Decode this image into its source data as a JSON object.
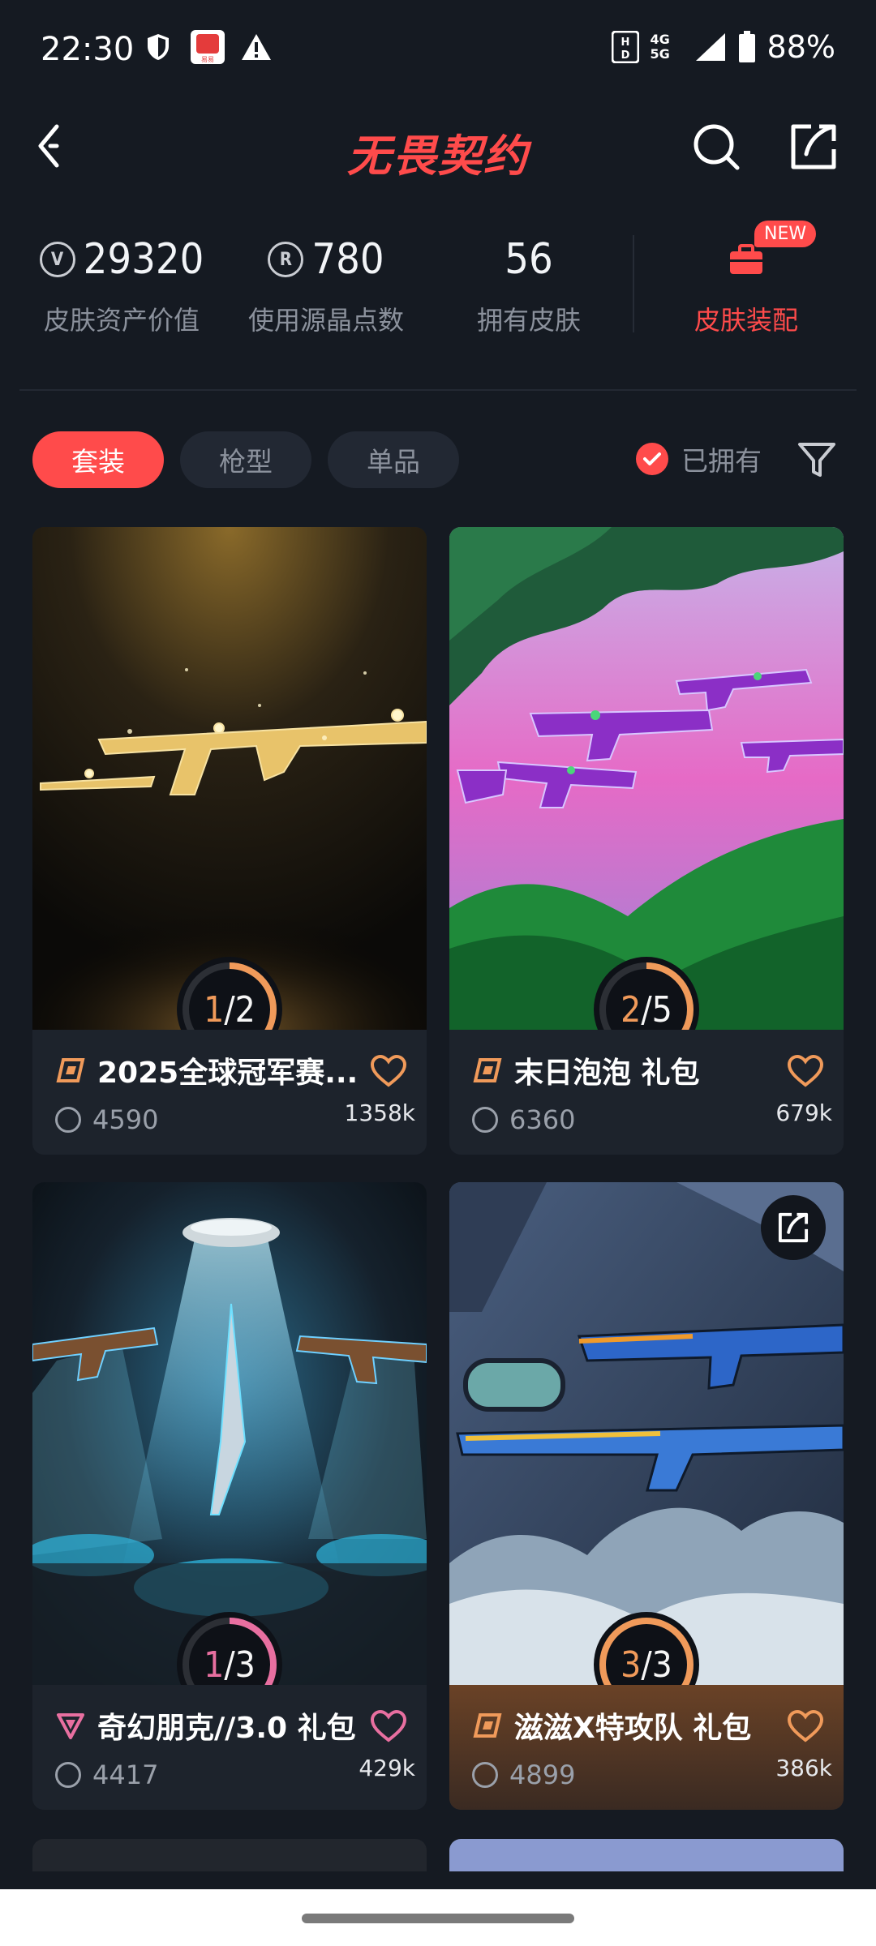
{
  "status_bar": {
    "time": "22:30",
    "network": "4G 5G",
    "battery": "88%",
    "icons": [
      "shield-icon",
      "app-notification-icon",
      "warning-icon",
      "hd-icon",
      "signal-icon",
      "battery-icon"
    ]
  },
  "header": {
    "title": "无畏契约",
    "back_icon": "back-arrow-icon",
    "search_icon": "search-icon",
    "share_icon": "share-icon"
  },
  "stats": [
    {
      "value": "29320",
      "label": "皮肤资产价值",
      "icon": "vp-coin-icon"
    },
    {
      "value": "780",
      "label": "使用源晶点数",
      "icon": "radianite-icon"
    },
    {
      "value": "56",
      "label": "拥有皮肤"
    }
  ],
  "equip": {
    "label": "皮肤装配",
    "badge": "NEW",
    "icon": "briefcase-icon"
  },
  "filters": {
    "tabs": [
      "套装",
      "枪型",
      "单品"
    ],
    "active_tab": "套装",
    "owned_label": "已拥有",
    "owned_checked": true
  },
  "cards": [
    {
      "title": "2025全球冠军赛...",
      "price": "4590",
      "likes": "1358k",
      "owned": 1,
      "total": 2,
      "progress_text_a": "1",
      "progress_text_b": "/2",
      "tier": "premium"
    },
    {
      "title": "末日泡泡 礼包",
      "price": "6360",
      "likes": "679k",
      "owned": 2,
      "total": 5,
      "progress_text_a": "2",
      "progress_text_b": "/5",
      "tier": "premium"
    },
    {
      "title": "奇幻朋克//3.0 礼包",
      "price": "4417",
      "likes": "429k",
      "owned": 1,
      "total": 3,
      "progress_text_a": "1",
      "progress_text_b": "/3",
      "tier": "exclusive"
    },
    {
      "title": "滋滋X特攻队 礼包",
      "price": "4899",
      "likes": "386k",
      "owned": 3,
      "total": 3,
      "progress_text_a": "3",
      "progress_text_b": "/3",
      "tier": "premium"
    }
  ],
  "colors": {
    "accent": "#ff4b4b",
    "background": "#151a22",
    "card": "#1d232c",
    "progress_orange": "#f09a5a",
    "progress_pink": "#e86fa0"
  }
}
